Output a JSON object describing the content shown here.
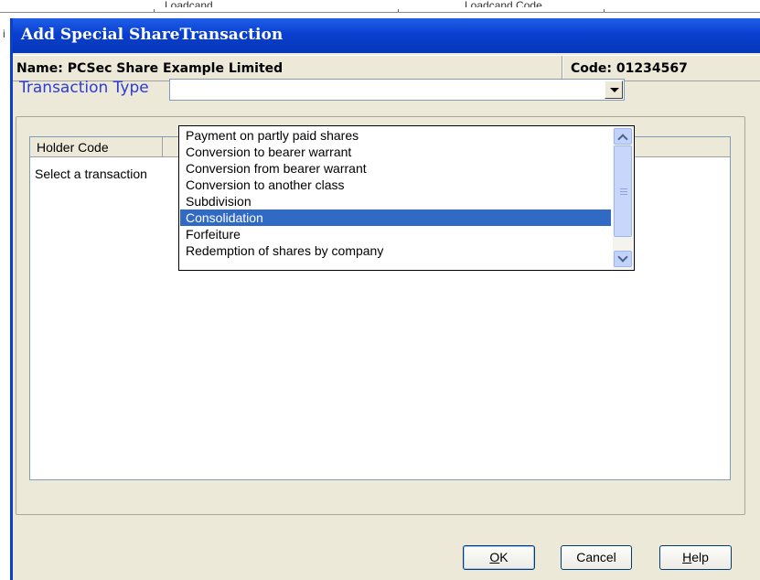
{
  "background_fragments": {
    "left_char": "i",
    "frag1": "Loadcand",
    "frag2": "Loadcand Code"
  },
  "dialog": {
    "title": "Add Special ShareTransaction",
    "name_label": "Name: PCSec Share Example Limited",
    "code_label": "Code: 01234567"
  },
  "transaction_type": {
    "label": "Transaction Type",
    "value": ""
  },
  "dropdown": {
    "options": [
      "Payment on partly paid shares",
      "Conversion to bearer warrant",
      "Conversion from bearer warrant",
      "Conversion to another class",
      "Subdivision",
      "Consolidation",
      "Forfeiture",
      "Redemption of shares by company"
    ],
    "selected": "Consolidation"
  },
  "grid": {
    "columns": [
      "Holder Code",
      ""
    ],
    "message": "Select a transaction"
  },
  "buttons": {
    "ok": "OK",
    "ok_mnemonic": "O",
    "cancel": "Cancel",
    "help": "Help",
    "help_mnemonic": "H"
  },
  "colors": {
    "titlebar": "#0a3fd0",
    "label_blue": "#2b3bd8",
    "selection": "#316ac5",
    "dialog_face": "#ece9d8"
  }
}
